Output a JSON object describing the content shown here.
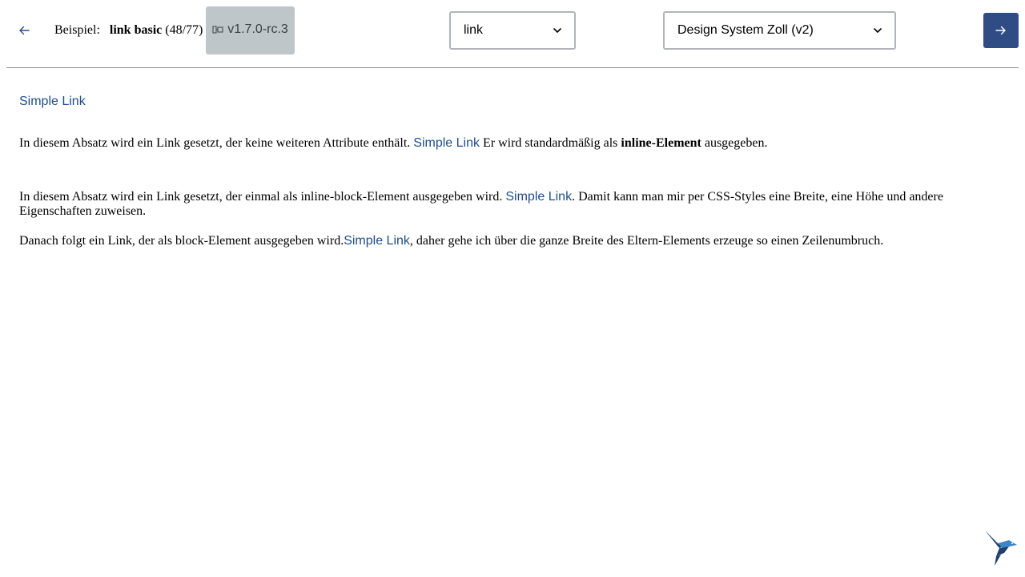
{
  "header": {
    "back_icon": "arrow-left-icon",
    "breadcrumb_label": "Beispiel:",
    "example_name": "link basic",
    "example_count": "(48/77)",
    "version": "v1.7.0-rc.3",
    "version_icon": "bookmark-icon",
    "component_select": {
      "value": "link",
      "icon": "chevron-down-icon"
    },
    "theme_select": {
      "value": "Design System Zoll (v2)",
      "icon": "chevron-down-icon"
    },
    "next_icon": "arrow-right-icon"
  },
  "content": {
    "title_link": "Simple Link",
    "paragraph1": {
      "before": "In diesem Absatz wird ein Link gesetzt, der keine weiteren Attribute enthält.",
      "link": "Simple Link",
      "after_plain": "Er wird standardmäßig als",
      "after_bold": "inline-Element",
      "after_end": "ausgegeben."
    },
    "paragraph2": {
      "before": "In diesem Absatz wird ein Link gesetzt, der einmal als inline-block-Element ausgegeben wird.",
      "link": "Simple Link",
      "after": ". Damit kann man mir per CSS-Styles eine Breite, eine Höhe und andere Eigenschaften zuweisen."
    },
    "paragraph3": {
      "before": "Danach folgt ein Link, der als block-Element ausgegeben wird.",
      "link": "Simple Link",
      "after": ", daher gehe ich über die ganze Breite des Eltern-Elements erzeuge so einen Zeilenumbruch."
    }
  },
  "logo": {
    "icon": "hummingbird-logo-icon"
  },
  "colors": {
    "link": "#1f4d88",
    "primary_button": "#2f4c85",
    "version_chip_bg": "#bfc6ca",
    "select_border": "#b1b5b9",
    "logo_dark": "#1f3f6b",
    "logo_light": "#3a86c8"
  }
}
